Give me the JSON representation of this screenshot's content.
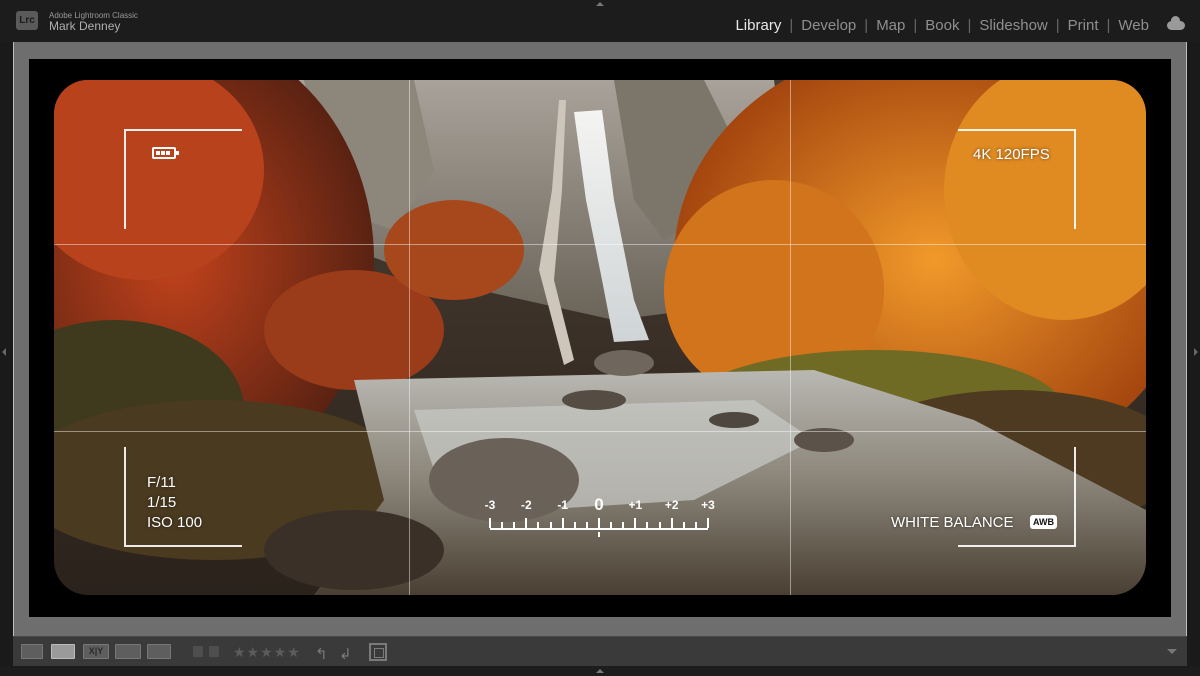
{
  "app": {
    "logo": "Lrc",
    "name": "Adobe Lightroom Classic",
    "user": "Mark Denney"
  },
  "modules": [
    {
      "label": "Library",
      "active": true
    },
    {
      "label": "Develop",
      "active": false
    },
    {
      "label": "Map",
      "active": false
    },
    {
      "label": "Book",
      "active": false
    },
    {
      "label": "Slideshow",
      "active": false
    },
    {
      "label": "Print",
      "active": false
    },
    {
      "label": "Web",
      "active": false
    }
  ],
  "module_separator": "|",
  "overlay": {
    "resolution": "4K 120FPS",
    "aperture": "F/11",
    "shutter": "1/15",
    "iso": "ISO 100",
    "white_balance_label": "WHITE BALANCE",
    "white_balance_badge": "AWB",
    "ev_labels": [
      "-3",
      "-2",
      "-1",
      "0",
      "+1",
      "+2",
      "+3"
    ],
    "battery_level_bars": 3
  },
  "toolbar": {
    "stars": "★★★★★",
    "compare_label": "X|Y"
  },
  "icons": {
    "battery": "battery-icon",
    "cloud": "cloud-icon",
    "grid_view": "grid-view-icon",
    "loupe_view": "loupe-view-icon",
    "compare_view": "compare-view-icon",
    "survey_view": "survey-view-icon",
    "people_view": "people-view-icon",
    "flag": "flag-icon",
    "rotate_left": "rotate-left-icon",
    "rotate_right": "rotate-right-icon",
    "crop": "crop-icon"
  },
  "colors": {
    "active_module": "#e8e8e8",
    "inactive_module": "#8f8f8f",
    "background": "#1c1c1c",
    "loupe_gray": "#6e6e6e"
  }
}
